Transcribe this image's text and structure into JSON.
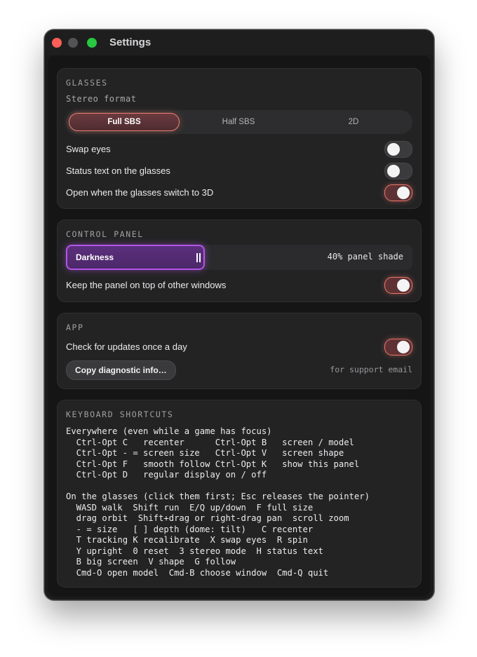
{
  "window": {
    "title": "Settings"
  },
  "glasses": {
    "header": "GLASSES",
    "stereo_label": "Stereo format",
    "segments": [
      {
        "label": "Full SBS",
        "selected": true
      },
      {
        "label": "Half SBS",
        "selected": false
      },
      {
        "label": "2D",
        "selected": false
      }
    ],
    "toggles": [
      {
        "label": "Swap eyes",
        "on": false
      },
      {
        "label": "Status text on the glasses",
        "on": false
      },
      {
        "label": "Open when the glasses switch to 3D",
        "on": true
      }
    ]
  },
  "control_panel": {
    "header": "CONTROL PANEL",
    "slider": {
      "label": "Darkness",
      "value": 0.4,
      "value_text": "40% panel shade"
    },
    "toggles": [
      {
        "label": "Keep the panel on top of other windows",
        "on": true
      }
    ]
  },
  "app": {
    "header": "APP",
    "toggles": [
      {
        "label": "Check for updates once a day",
        "on": true
      }
    ],
    "button_label": "Copy diagnostic info…",
    "hint": "for support email"
  },
  "shortcuts": {
    "header": "KEYBOARD SHORTCUTS",
    "text": "Everywhere (even while a game has focus)\n  Ctrl-Opt C   recenter      Ctrl-Opt B   screen / model\n  Ctrl-Opt - = screen size   Ctrl-Opt V   screen shape\n  Ctrl-Opt F   smooth follow Ctrl-Opt K   show this panel\n  Ctrl-Opt D   regular display on / off\n\nOn the glasses (click them first; Esc releases the pointer)\n  WASD walk  Shift run  E/Q up/down  F full size\n  drag orbit  Shift+drag or right-drag pan  scroll zoom\n  - = size   [ ] depth (dome: tilt)   C recenter\n  T tracking K recalibrate  X swap eyes  R spin\n  Y upright  0 reset  3 stereo mode  H status text\n  B big screen  V shape  G follow\n  Cmd-O open model  Cmd-B choose window  Cmd-Q quit"
  },
  "colors": {
    "toggle_on_accent": "#ea7669",
    "slider_accent": "#b255e6",
    "background": "#151515"
  }
}
